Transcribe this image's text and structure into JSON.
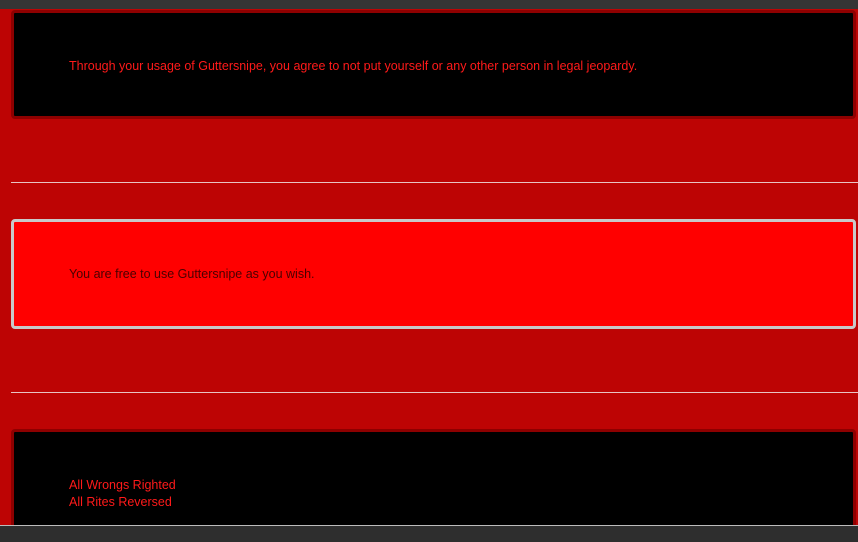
{
  "notices": {
    "legal": "Through your usage of Guttersnipe, you agree to not put yourself or any other person in legal jeopardy.",
    "license": "You are free to use Guttersnipe as you wish."
  },
  "footer": {
    "line1": "All Wrongs Righted",
    "line2": "All Rites Reversed"
  },
  "colors": {
    "page_background": "#bd0404",
    "dark_panel": "#000000",
    "bright_panel": "#ff0000",
    "accent_text": "#ff1a1a"
  }
}
